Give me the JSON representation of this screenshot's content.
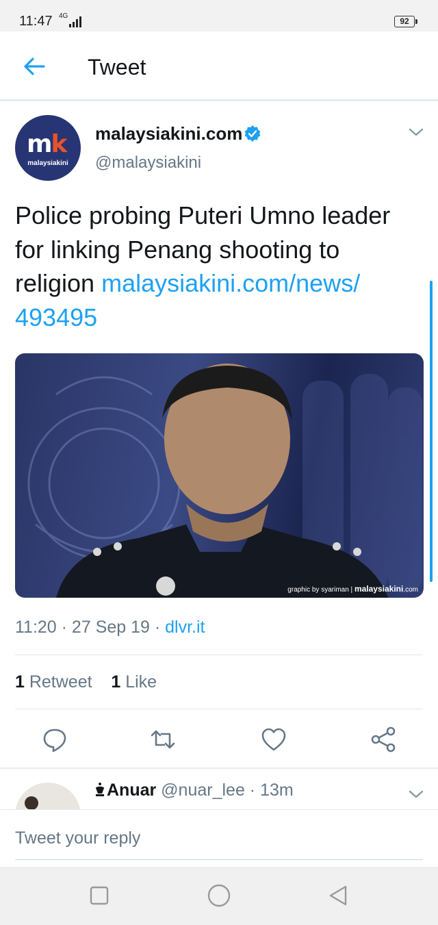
{
  "status": {
    "time": "11:47",
    "network": "4G",
    "battery": "92"
  },
  "header": {
    "title": "Tweet"
  },
  "tweet": {
    "author": "malaysiakini.com",
    "handle": "@malaysiakini",
    "avatar_mark": "mk",
    "avatar_caption": "malaysiakini",
    "text": "Police probing Puteri Umno leader for linking Penang shooting to religion ",
    "link": "malaysiakini.com/news/ 493495",
    "image_credit_small": "graphic by syariman |",
    "image_credit_brand": "malaysiakini",
    "image_credit_tld": ".com",
    "time": "11:20 · 27 Sep 19 · ",
    "source": "dlvr.it",
    "retweets": "1",
    "retweets_label": " Retweet",
    "likes": "1",
    "likes_label": " Like"
  },
  "reply": {
    "name": "Anuar",
    "handle": " @nuar_lee · 13m"
  },
  "composer": {
    "placeholder": "Tweet your reply"
  },
  "colors": {
    "accent": "#1da1f2",
    "brand_navy": "#273574",
    "brand_orange": "#e8532b"
  },
  "icons": [
    "back-arrow-icon",
    "verified-badge-icon",
    "chevron-down-icon",
    "reply-icon",
    "retweet-icon",
    "like-icon",
    "share-icon",
    "square-nav-icon",
    "circle-nav-icon",
    "triangle-back-nav-icon"
  ]
}
